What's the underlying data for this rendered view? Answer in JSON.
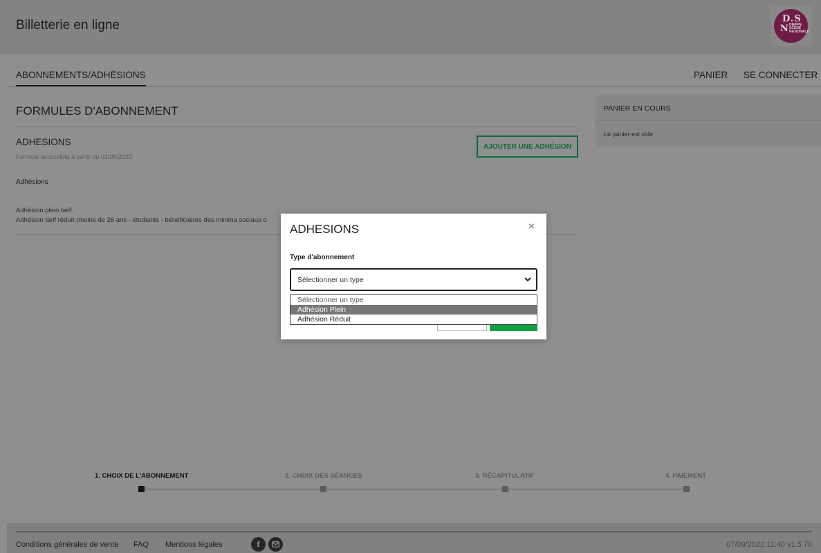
{
  "header": {
    "title": "Billetterie en ligne",
    "logo": {
      "line1": "D.S",
      "line2": "N",
      "tagline": "DIEPPE SCÈNE NATIONALE"
    }
  },
  "nav": {
    "active": "ABONNEMENTS/ADHÉSIONS",
    "cart": "PANIER",
    "login": "SE CONNECTER"
  },
  "main": {
    "heading": "FORMULES D'ABONNEMENT",
    "section_title": "ADHESIONS",
    "section_sub": "Formule accessible à partir du 01/09/2022",
    "add_button": "AJOUTER UNE ADHÉSION",
    "subheading": "Adhésions",
    "desc_line1": "Adhésion plein tarif.",
    "desc_line2": "Adhésion tarif réduit (moins de 26 ans - étudiants - bénéficiaires des minima sociaux o"
  },
  "cart": {
    "title": "PANIER EN COURS",
    "empty": "Le panier est vide"
  },
  "steps": [
    {
      "label": "1. CHOIX DE L'ABONNEMENT",
      "active": true
    },
    {
      "label": "2. CHOIX DES SÉANCES",
      "active": false
    },
    {
      "label": "3. RÉCAPITULATIF",
      "active": false
    },
    {
      "label": "4. PAIEMENT",
      "active": false
    }
  ],
  "footer": {
    "links": [
      "Conditions générales de vente",
      "FAQ",
      "Mentions légales"
    ],
    "social_icons": [
      "facebook-icon",
      "mail-icon"
    ],
    "meta": "07/09/2022 11:40  v1.5.70"
  },
  "modal": {
    "title": "ADHESIONS",
    "close": "×",
    "field_label": "Type d'abonnement",
    "select_value": "Sélectionner un type",
    "options": [
      "Sélectionner un type",
      "Adhésion Plein",
      "Adhésion Réduit"
    ],
    "highlighted_option": "Adhésion Plein"
  },
  "colors": {
    "accent_green": "#0ea043",
    "brand_magenta": "#c2185b",
    "overlay": "#8f8f8f"
  }
}
